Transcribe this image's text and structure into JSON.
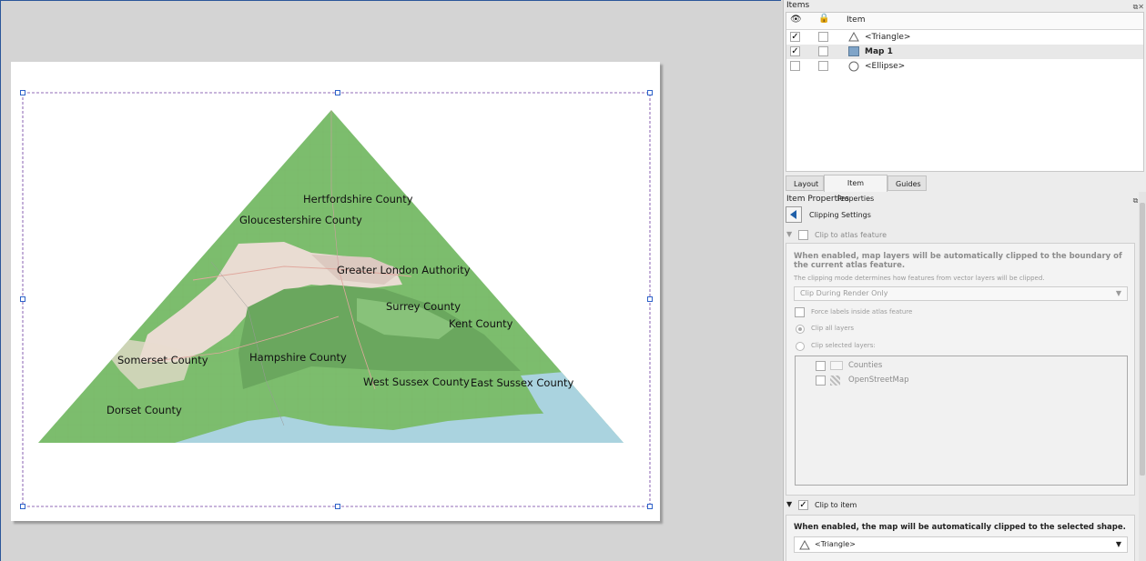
{
  "map": {
    "labels": [
      {
        "id": "hertfordshire",
        "text": "Hertfordshire County"
      },
      {
        "id": "gloucestershire",
        "text": "Gloucestershire County"
      },
      {
        "id": "greater-london",
        "text": "Greater London Authority"
      },
      {
        "id": "surrey",
        "text": "Surrey County"
      },
      {
        "id": "kent",
        "text": "Kent County"
      },
      {
        "id": "somerset",
        "text": "Somerset County"
      },
      {
        "id": "hampshire",
        "text": "Hampshire County"
      },
      {
        "id": "west-sussex",
        "text": "West Sussex County"
      },
      {
        "id": "east-sussex",
        "text": "East Sussex County"
      },
      {
        "id": "dorset",
        "text": "Dorset County"
      }
    ],
    "colors": {
      "land": "#7cbd6d",
      "land_dark": "#6aa75e",
      "urban": "#ead9d0",
      "sea": "#aad3df",
      "border": "#6d3ba0"
    }
  },
  "items_panel": {
    "title": "Items",
    "column_item": "Item",
    "rows": [
      {
        "label": "<Triangle>",
        "visible": true,
        "locked": false,
        "icon": "triangle-icon"
      },
      {
        "label": "Map 1",
        "visible": true,
        "locked": false,
        "icon": "map-icon"
      },
      {
        "label": "<Ellipse>",
        "visible": false,
        "locked": false,
        "icon": "ellipse-icon"
      }
    ]
  },
  "tabs": {
    "layout": "Layout",
    "item_properties": "Item Properties",
    "guides": "Guides"
  },
  "item_properties": {
    "title": "Item Properties",
    "subtitle": "Clipping Settings",
    "clip_atlas": {
      "label": "Clip to atlas feature",
      "checked": false,
      "desc": "When enabled, map layers will be automatically clipped to the boundary of the current atlas feature.",
      "mode_desc": "The clipping mode determines how features from vector layers will be clipped.",
      "mode_value": "Clip During Render Only",
      "force_labels": "Force labels inside atlas feature",
      "clip_all": "Clip all layers",
      "clip_selected": "Clip selected layers:",
      "layers": [
        "Counties",
        "OpenStreetMap"
      ]
    },
    "clip_item": {
      "label": "Clip to item",
      "checked": true,
      "desc": "When enabled, the map will be automatically clipped to the selected shape.",
      "shape_value": "<Triangle>"
    }
  }
}
